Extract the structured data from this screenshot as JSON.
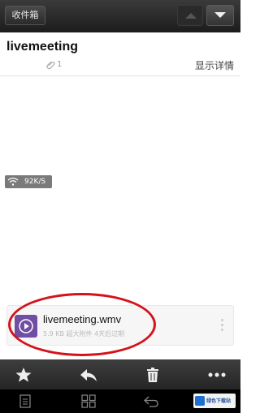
{
  "header": {
    "back_label": "收件箱",
    "prev_icon": "chevron-up-icon",
    "next_icon": "chevron-down-icon"
  },
  "message": {
    "subject": "livemeeting",
    "attachment_count": "1",
    "details_label": "显示详情"
  },
  "network": {
    "speed": "92K/S"
  },
  "attachment": {
    "name": "livemeeting.wmv",
    "info": "5.9 KB  超大附件  4天后过期"
  },
  "actions": [
    "star-icon",
    "reply-icon",
    "trash-icon",
    "more-icon"
  ],
  "system_nav": [
    "menu-icon",
    "home-icon",
    "back-icon"
  ],
  "watermark": {
    "text": "绿色下载站"
  },
  "colors": {
    "highlight": "#d4121c",
    "file_icon": "#6f4ea3",
    "bar": "#2b2b2b"
  }
}
